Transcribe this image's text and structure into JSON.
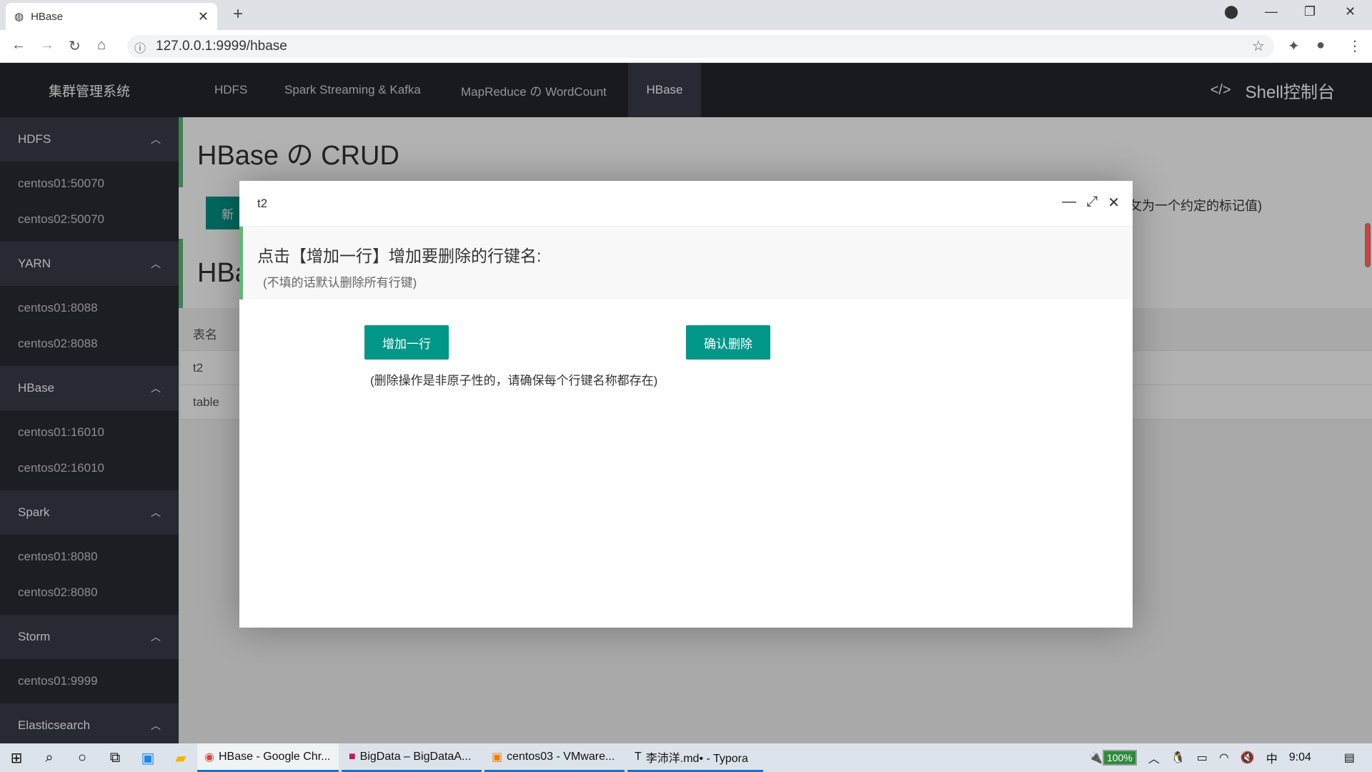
{
  "browser": {
    "tab_title": "HBase",
    "url": "127.0.0.1:9999/hbase"
  },
  "app": {
    "logo": "集群管理系统",
    "nav": [
      "HDFS",
      "Spark Streaming & Kafka",
      "MapReduce の WordCount",
      "HBase"
    ],
    "active_nav": "HBase",
    "shell": "Shell控制台"
  },
  "sidebar": [
    {
      "label": "HDFS",
      "items": [
        "centos01:50070",
        "centos02:50070"
      ]
    },
    {
      "label": "YARN",
      "items": [
        "centos01:8088",
        "centos02:8088"
      ]
    },
    {
      "label": "HBase",
      "items": [
        "centos01:16010",
        "centos02:16010"
      ]
    },
    {
      "label": "Spark",
      "items": [
        "centos01:8080",
        "centos02:8080"
      ]
    },
    {
      "label": "Storm",
      "items": [
        "centos01:9999"
      ]
    },
    {
      "label": "Elasticsearch",
      "items": []
    }
  ],
  "page": {
    "title": "HBase の CRUD",
    "new_button": "新",
    "hint_tail": "攵为一个约定的标记值)",
    "section2_title": "HBa",
    "table": {
      "header": "表名",
      "rows": [
        "t2",
        "table"
      ]
    }
  },
  "modal": {
    "title": "t2",
    "instruction": "点击【增加一行】增加要删除的行键名:",
    "sub": "(不填的话默认删除所有行键)",
    "add_row": "增加一行",
    "confirm_delete": "确认删除",
    "note": "(删除操作是非原子性的，请确保每个行键名称都存在)"
  },
  "taskbar": {
    "apps": [
      "HBase - Google Chr...",
      "BigData – BigDataA...",
      "centos03 - VMware...",
      "李沛洋.md• - Typora"
    ],
    "battery": "100%",
    "ime": "中",
    "time": "9:04"
  },
  "colors": {
    "accent": "#009688",
    "quote_border": "#5fb878",
    "sidebar": "#393d49",
    "header": "#23262e"
  }
}
